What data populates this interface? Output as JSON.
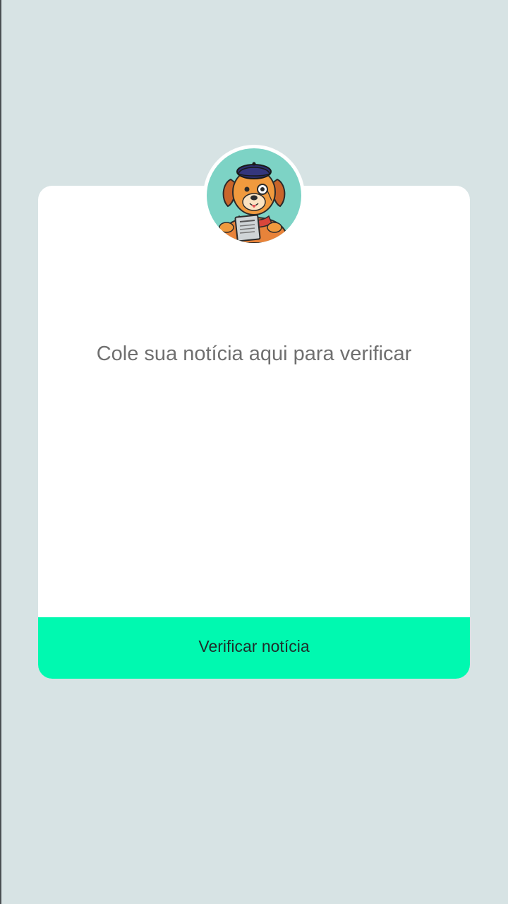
{
  "mascot": {
    "icon": "dog-detective-avatar-icon",
    "background_color": "#7dd3c5"
  },
  "news_form": {
    "placeholder": "Cole sua notícia aqui para verificar",
    "value": ""
  },
  "verify_button": {
    "label": "Verificar notícia",
    "color": "#00f9b0"
  },
  "colors": {
    "page_background": "#d7e3e4",
    "card_background": "#ffffff"
  }
}
